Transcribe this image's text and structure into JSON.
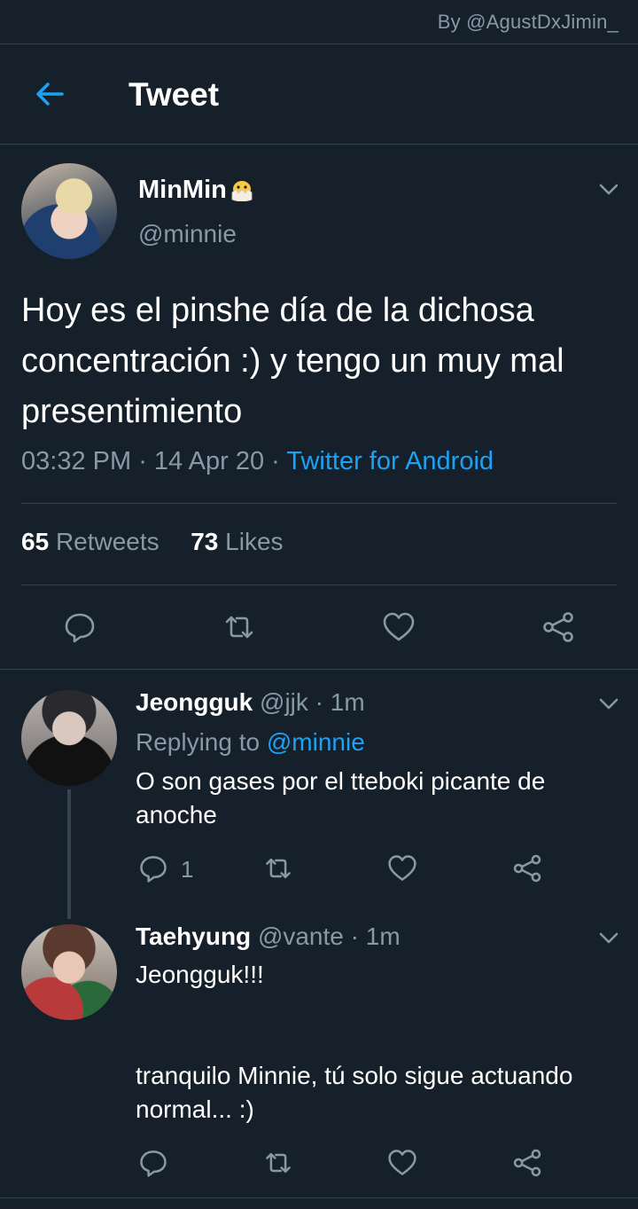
{
  "watermark": "By @AgustDxJimin_",
  "header": {
    "title": "Tweet"
  },
  "tweet": {
    "name": "MinMin",
    "handle": "@minnie",
    "text": "Hoy es el pinshe día de la dichosa concentración :) y tengo un muy mal presentimiento",
    "time": "03:32 PM",
    "date": "14 Apr 20",
    "source": "Twitter for Android",
    "retweets_count": "65",
    "retweets_label": "Retweets",
    "likes_count": "73",
    "likes_label": "Likes"
  },
  "replies": [
    {
      "name": "Jeongguk",
      "handle": "@jjk",
      "time": "1m",
      "replying_prefix": "Replying to",
      "replying_to": "@minnie",
      "text_line1": "O son gases por el tteboki picante de",
      "text_line2": "anoche",
      "reply_count": "1"
    },
    {
      "name": "Taehyung",
      "handle": "@vante",
      "time": "1m",
      "text_line1": "Jeongguk!!!",
      "text_line2": "tranquilo Minnie, tú solo sigue actuando",
      "text_line3": "normal... :)"
    }
  ],
  "colors": {
    "background": "#15202b",
    "accent": "#1da1f2",
    "muted": "#8899a6",
    "divider": "#38444d"
  },
  "icons": [
    "back-arrow-icon",
    "chick-emoji-icon",
    "chevron-down-icon",
    "reply-icon",
    "retweet-icon",
    "like-icon",
    "share-icon"
  ]
}
